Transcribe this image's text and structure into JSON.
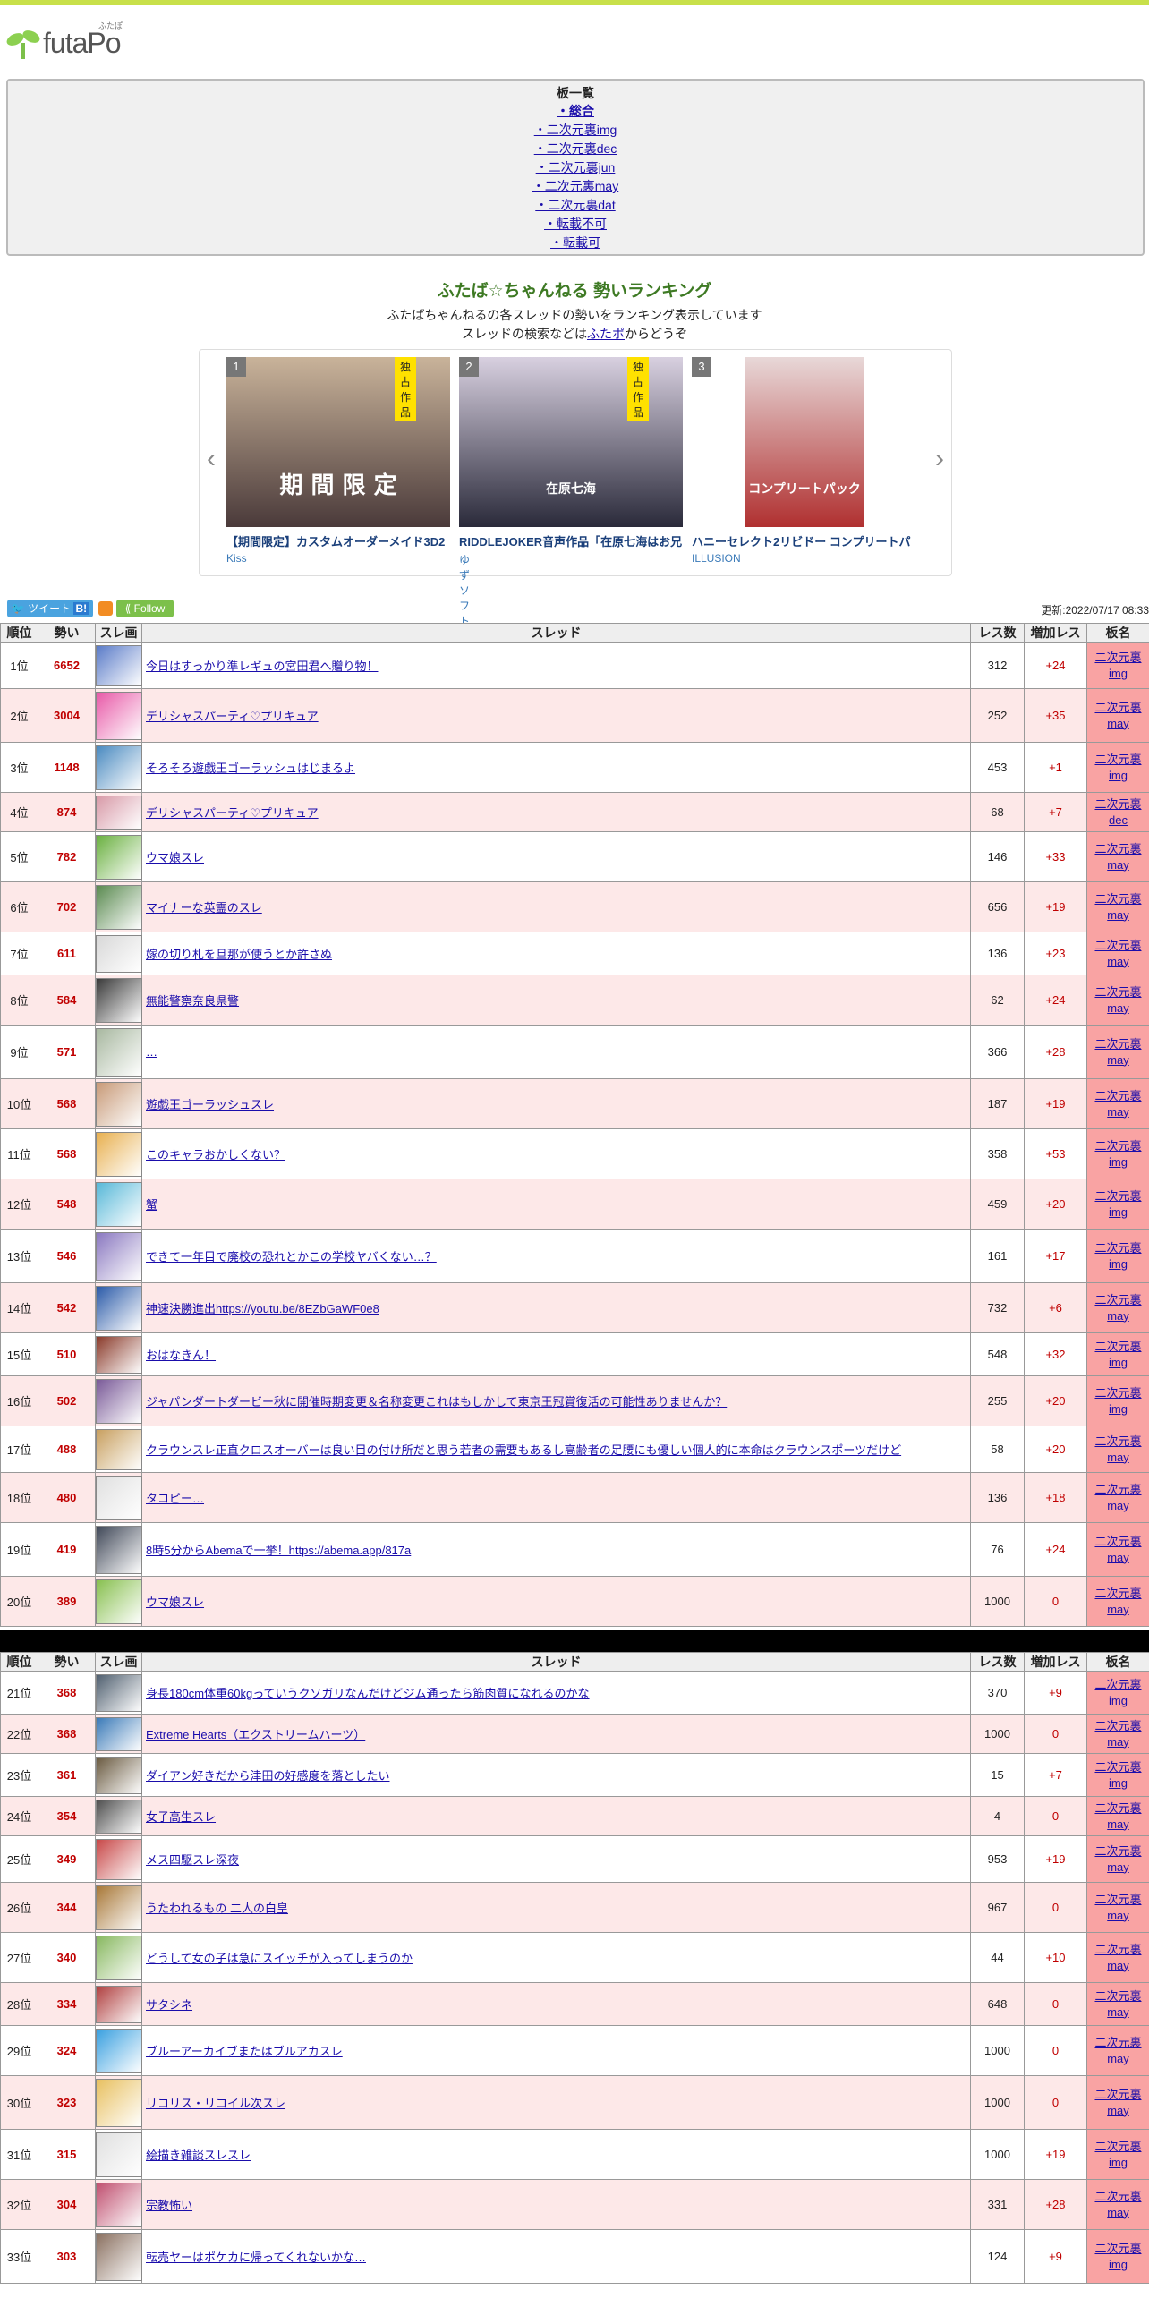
{
  "logo": {
    "text": "futaPo",
    "ruby": "ふたぽ"
  },
  "boards": {
    "title": "板一覧",
    "items": [
      {
        "label": "・総合",
        "active": true
      },
      {
        "label": "・二次元裏img"
      },
      {
        "label": "・二次元裏dec"
      },
      {
        "label": "・二次元裏jun"
      },
      {
        "label": "・二次元裏may"
      },
      {
        "label": "・二次元裏dat"
      },
      {
        "label": "・転載不可"
      },
      {
        "label": "・転載可"
      }
    ]
  },
  "header": {
    "title": "ふたば☆ちゃんねる 勢いランキング",
    "desc1": "ふたばちゃんねるの各スレッドの勢いをランキング表示しています",
    "desc2_pre": "スレッドの検索などは",
    "desc2_link": "ふたポ",
    "desc2_post": "からどうぞ"
  },
  "carousel": {
    "items": [
      {
        "rank": "1",
        "badge": "独占作品",
        "title": "【期間限定】カスタムオーダーメイド3D2",
        "brand": "Kiss",
        "img_text": "期 間 限 定",
        "colors": [
          "#4a3a3a",
          "#c9b39a"
        ]
      },
      {
        "rank": "2",
        "badge": "独占作品",
        "title": "RIDDLEJOKER音声作品「在原七海はお兄",
        "brand": "ゆずソフト",
        "img_text": "在原七海",
        "colors": [
          "#2a2a3a",
          "#d8d0e0"
        ]
      },
      {
        "rank": "3",
        "badge": "",
        "title": "ハニーセレクト2リビドー コンプリートパ",
        "brand": "ILLUSION",
        "img_text": "コンプリートパック",
        "colors": [
          "#b03030",
          "#e8d8d8"
        ]
      }
    ]
  },
  "share": {
    "tweet": "ツイート",
    "hatena": "B!",
    "follow": "Follow"
  },
  "updated": "更新:2022/07/17 08:33",
  "table": {
    "headers": [
      "順位",
      "勢い",
      "スレ画",
      "スレッド",
      "レス数",
      "増加レス",
      "板名"
    ],
    "rows1": [
      {
        "rank": "1位",
        "ikioi": "6652",
        "title": "今日はすっかり準レギュの宮田君へ贈り物！",
        "res": "312",
        "inc": "+24",
        "board1": "二次元裏",
        "board2": "img",
        "color": "#5a7bc8"
      },
      {
        "rank": "2位",
        "ikioi": "3004",
        "title": "デリシャスパーティ♡プリキュア",
        "res": "252",
        "inc": "+35",
        "board1": "二次元裏",
        "board2": "may",
        "color": "#e85aa8"
      },
      {
        "rank": "3位",
        "ikioi": "1148",
        "title": "そろそろ遊戯王ゴーラッシュはじまるよ",
        "res": "453",
        "inc": "+1",
        "board1": "二次元裏",
        "board2": "img",
        "color": "#4a8ac0"
      },
      {
        "rank": "4位",
        "ikioi": "874",
        "title": "デリシャスパーティ♡プリキュア",
        "res": "68",
        "inc": "+7",
        "board1": "二次元裏",
        "board2": "dec",
        "color": "#d89aa8"
      },
      {
        "rank": "5位",
        "ikioi": "782",
        "title": "ウマ娘スレ",
        "res": "146",
        "inc": "+33",
        "board1": "二次元裏",
        "board2": "may",
        "color": "#6ab040"
      },
      {
        "rank": "6位",
        "ikioi": "702",
        "title": "マイナーな英霊のスレ",
        "res": "656",
        "inc": "+19",
        "board1": "二次元裏",
        "board2": "may",
        "color": "#5a8a50"
      },
      {
        "rank": "7位",
        "ikioi": "611",
        "title": "嫁の切り札を旦那が使うとか許さぬ",
        "res": "136",
        "inc": "+23",
        "board1": "二次元裏",
        "board2": "may",
        "color": "#d8d8d8"
      },
      {
        "rank": "8位",
        "ikioi": "584",
        "title": "無能警察奈良県警",
        "res": "62",
        "inc": "+24",
        "board1": "二次元裏",
        "board2": "may",
        "color": "#3a3a3a"
      },
      {
        "rank": "9位",
        "ikioi": "571",
        "title": "…",
        "res": "366",
        "inc": "+28",
        "board1": "二次元裏",
        "board2": "may",
        "color": "#a8b8a0"
      },
      {
        "rank": "10位",
        "ikioi": "568",
        "title": "遊戯王ゴーラッシュスレ",
        "res": "187",
        "inc": "+19",
        "board1": "二次元裏",
        "board2": "may",
        "color": "#c89a78"
      },
      {
        "rank": "11位",
        "ikioi": "568",
        "title": "このキャラおかしくない？",
        "res": "358",
        "inc": "+53",
        "board1": "二次元裏",
        "board2": "img",
        "color": "#e8b050"
      },
      {
        "rank": "12位",
        "ikioi": "548",
        "title": "蟹",
        "res": "459",
        "inc": "+20",
        "board1": "二次元裏",
        "board2": "img",
        "color": "#58b8d8"
      },
      {
        "rank": "13位",
        "ikioi": "546",
        "title": "できて一年目で廃校の恐れとかこの学校ヤバくない…？",
        "res": "161",
        "inc": "+17",
        "board1": "二次元裏",
        "board2": "img",
        "color": "#8a78c0"
      },
      {
        "rank": "14位",
        "ikioi": "542",
        "title": "神速決勝進出https://youtu.be/8EZbGaWF0e8",
        "res": "732",
        "inc": "+6",
        "board1": "二次元裏",
        "board2": "may",
        "color": "#2a5aa8"
      },
      {
        "rank": "15位",
        "ikioi": "510",
        "title": "おはなきん！",
        "res": "548",
        "inc": "+32",
        "board1": "二次元裏",
        "board2": "img",
        "color": "#8a3a2a"
      },
      {
        "rank": "16位",
        "ikioi": "502",
        "title": "ジャパンダートダービー秋に開催時期変更＆名称変更これはもしかして東京王冠賞復活の可能性ありませんか？",
        "res": "255",
        "inc": "+20",
        "board1": "二次元裏",
        "board2": "img",
        "color": "#7a5a98"
      },
      {
        "rank": "17位",
        "ikioi": "488",
        "title": "クラウンスレ正直クロスオーバーは良い目の付け所だと思う若者の需要もあるし高齢者の足腰にも優しい個人的に本命はクラウンスポーツだけど",
        "res": "58",
        "inc": "+20",
        "board1": "二次元裏",
        "board2": "may",
        "color": "#c8a060"
      },
      {
        "rank": "18位",
        "ikioi": "480",
        "title": "タコピー…",
        "res": "136",
        "inc": "+18",
        "board1": "二次元裏",
        "board2": "may",
        "color": "#e0e0e0"
      },
      {
        "rank": "19位",
        "ikioi": "419",
        "title": "8時5分からAbemaで一挙！https://abema.app/817a",
        "res": "76",
        "inc": "+24",
        "board1": "二次元裏",
        "board2": "may",
        "color": "#404858"
      },
      {
        "rank": "20位",
        "ikioi": "389",
        "title": "ウマ娘スレ",
        "res": "1000",
        "inc": "0",
        "board1": "二次元裏",
        "board2": "may",
        "color": "#88c050"
      }
    ],
    "rows2": [
      {
        "rank": "21位",
        "ikioi": "368",
        "title": "身長180cm体重60kgっていうクソガリなんだけどジム通ったら筋肉質になれるのかな",
        "res": "370",
        "inc": "+9",
        "board1": "二次元裏",
        "board2": "img",
        "color": "#506070"
      },
      {
        "rank": "22位",
        "ikioi": "368",
        "title": "Extreme Hearts（エクストリームハーツ）",
        "res": "1000",
        "inc": "0",
        "board1": "二次元裏",
        "board2": "may",
        "color": "#3a7ab8"
      },
      {
        "rank": "23位",
        "ikioi": "361",
        "title": "ダイアン好きだから津田の好感度を落としたい",
        "res": "15",
        "inc": "+7",
        "board1": "二次元裏",
        "board2": "img",
        "color": "#6a5a40"
      },
      {
        "rank": "24位",
        "ikioi": "354",
        "title": "女子高生スレ",
        "res": "4",
        "inc": "0",
        "board1": "二次元裏",
        "board2": "may",
        "color": "#505050"
      },
      {
        "rank": "25位",
        "ikioi": "349",
        "title": "メス四駆スレ深夜",
        "res": "953",
        "inc": "+19",
        "board1": "二次元裏",
        "board2": "may",
        "color": "#c84848"
      },
      {
        "rank": "26位",
        "ikioi": "344",
        "title": "うたわれるもの 二人の白皇",
        "res": "967",
        "inc": "0",
        "board1": "二次元裏",
        "board2": "may",
        "color": "#a87838"
      },
      {
        "rank": "27位",
        "ikioi": "340",
        "title": "どうして女の子は急にスイッチが入ってしまうのか",
        "res": "44",
        "inc": "+10",
        "board1": "二次元裏",
        "board2": "may",
        "color": "#88b860"
      },
      {
        "rank": "28位",
        "ikioi": "334",
        "title": "サタシネ",
        "res": "648",
        "inc": "0",
        "board1": "二次元裏",
        "board2": "may",
        "color": "#b04040"
      },
      {
        "rank": "29位",
        "ikioi": "324",
        "title": "ブルーアーカイブまたはブルアカスレ",
        "res": "1000",
        "inc": "0",
        "board1": "二次元裏",
        "board2": "may",
        "color": "#3aa0e0"
      },
      {
        "rank": "30位",
        "ikioi": "323",
        "title": "リコリス・リコイル次スレ",
        "res": "1000",
        "inc": "0",
        "board1": "二次元裏",
        "board2": "may",
        "color": "#e8c060"
      },
      {
        "rank": "31位",
        "ikioi": "315",
        "title": "絵描き雑談スレスレ",
        "res": "1000",
        "inc": "+19",
        "board1": "二次元裏",
        "board2": "img",
        "color": "#e0e0e0"
      },
      {
        "rank": "32位",
        "ikioi": "304",
        "title": "宗教怖い",
        "res": "331",
        "inc": "+28",
        "board1": "二次元裏",
        "board2": "may",
        "color": "#c05070"
      },
      {
        "rank": "33位",
        "ikioi": "303",
        "title": "転売ヤーはポケカに帰ってくれないかな…",
        "res": "124",
        "inc": "+9",
        "board1": "二次元裏",
        "board2": "img",
        "color": "#8a7060"
      }
    ]
  }
}
